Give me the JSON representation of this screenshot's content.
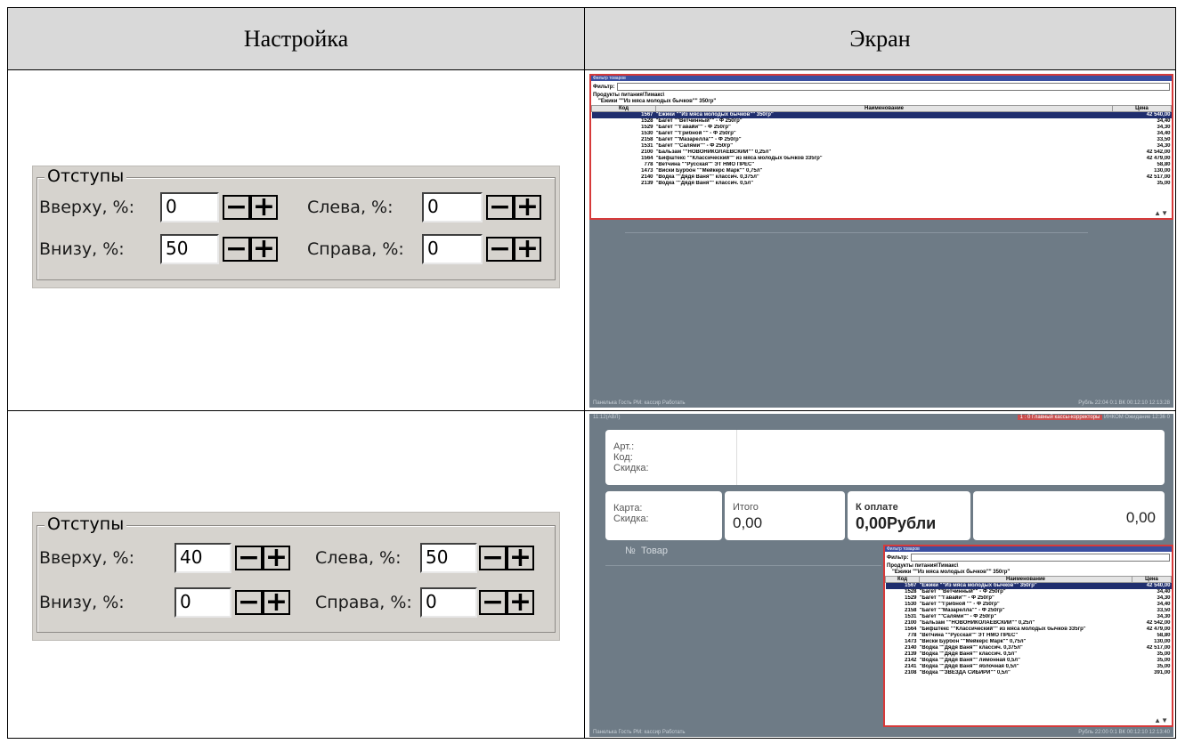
{
  "header": {
    "col1": "Настройка",
    "col2": "Экран"
  },
  "settings": {
    "group_title": "Отступы",
    "labels": {
      "top": "Вверху, %:",
      "bottom": "Внизу, %:",
      "left": "Слева, %:",
      "right": "Справа, %:"
    },
    "minus": "−",
    "plus": "+",
    "row1": {
      "top": "0",
      "bottom": "50",
      "left": "0",
      "right": "0"
    },
    "row2": {
      "top": "40",
      "bottom": "0",
      "left": "50",
      "right": "0"
    }
  },
  "screen": {
    "popup_title": "Фильтр товаров",
    "filter_label": "Фильтр:",
    "crumb1": "Продукты питания\\Тимакс\\",
    "crumb2": "\"Ежики \"\"Из мяса молодых бычков\"\" 350гр\"",
    "col_code": "Код",
    "col_name": "Наименование",
    "col_price": "Цена",
    "items1": [
      {
        "k": "1567",
        "n": "\"Ежики \"\"Из мяса молодых бычков\"\" 350гр\"",
        "p": "42 540,00"
      },
      {
        "k": "1528",
        "n": "\"Багет \"\"Ветчинный\"\" - Ф 250гр\"",
        "p": "34,40"
      },
      {
        "k": "1529",
        "n": "\"Багет \"\"Гавайи\"\" - Ф 250гр\"",
        "p": "34,30"
      },
      {
        "k": "1530",
        "n": "\"Багет \"\"Грибной \"\" - Ф 250гр\"",
        "p": "34,40"
      },
      {
        "k": "2158",
        "n": "\"Багет \"\"Мазарелла\"\" - Ф 250гр\"",
        "p": "33,50"
      },
      {
        "k": "1531",
        "n": "\"Багет \"\"Салями\"\" - Ф 250гр\"",
        "p": "34,30"
      },
      {
        "k": "2100",
        "n": "\"Бальзам \"\"НОВОНИКОЛАЕВСКИЙ\"\" 0,25л\"",
        "p": "42 542,00"
      },
      {
        "k": "1564",
        "n": "\"Бифштекс \"\"Классический\"\" из мяса молодых бычков 335гр\"",
        "p": "42 479,00"
      },
      {
        "k": "778",
        "n": "\"Ветчина \"\"Русская\"\" ЭТ НМО ПРЕС\"",
        "p": "58,80"
      },
      {
        "k": "1473",
        "n": "\"Виски Бурбон \"\"Мейкерс Марк\"\" 0,75л\"",
        "p": "130,00"
      },
      {
        "k": "2140",
        "n": "\"Водка \"\"Дядя Ваня\"\" классич. 0,375л\"",
        "p": "42 517,00"
      },
      {
        "k": "2139",
        "n": "\"Водка \"\"Дядя Ваня\"\" классич. 0,5л\"",
        "p": "35,00"
      }
    ],
    "items2": [
      {
        "k": "1567",
        "n": "\"Ежики \"\"Из мяса молодых бычков\"\" 350гр\"",
        "p": "42 540,00"
      },
      {
        "k": "1528",
        "n": "\"Багет \"\"Ветчинный\"\" - Ф 250гр\"",
        "p": "34,40"
      },
      {
        "k": "1529",
        "n": "\"Багет \"\"Гавайи\"\" - Ф 250гр\"",
        "p": "34,30"
      },
      {
        "k": "1530",
        "n": "\"Багет \"\"Грибной \"\" - Ф 250гр\"",
        "p": "34,40"
      },
      {
        "k": "2158",
        "n": "\"Багет \"\"Мазарелла\"\" - Ф 250гр\"",
        "p": "33,50"
      },
      {
        "k": "1531",
        "n": "\"Багет \"\"Салями\"\" - Ф 250гр\"",
        "p": "34,30"
      },
      {
        "k": "2100",
        "n": "\"Бальзам \"\"НОВОНИКОЛАЕВСКИЙ\"\" 0,25л\"",
        "p": "42 542,00"
      },
      {
        "k": "1564",
        "n": "\"Бифштекс \"\"Классический\"\" из мяса молодых бычков 335гр\"",
        "p": "42 479,00"
      },
      {
        "k": "778",
        "n": "\"Ветчина \"\"Русская\"\" ЭТ НМО ПРЕС\"",
        "p": "58,80"
      },
      {
        "k": "1473",
        "n": "\"Виски Бурбон \"\"Мейкерс Марк\"\" 0,75л\"",
        "p": "130,00"
      },
      {
        "k": "2140",
        "n": "\"Водка \"\"Дядя Ваня\"\" классич. 0,375л\"",
        "p": "42 517,00"
      },
      {
        "k": "2139",
        "n": "\"Водка \"\"Дядя Ваня\"\" классич. 0,5л\"",
        "p": "35,00"
      },
      {
        "k": "2142",
        "n": "\"Водка \"\"Дядя Ваня\"\" лимонная 0,5л\"",
        "p": "35,00"
      },
      {
        "k": "2141",
        "n": "\"Водка \"\"Дядя Ваня\"\" яблочная 0,5л\"",
        "p": "35,00"
      },
      {
        "k": "2108",
        "n": "\"Водка \"\"ЗВЕЗДА СИБИРИ\"\" 0,5л\"",
        "p": "391,00"
      }
    ],
    "taskbar_left": "Панелька Гость   РМ: кассир   Работать",
    "taskbar_right1": "Рубль   22:04   0:1   ВК 00:12:10  12:13:28",
    "taskbar_right2": "Рубль   22:00   0:1   ВК 00:12:10  12:13:40",
    "top_left": "11:12(АВЛ)",
    "top_red": "1 : 0   Главный кассы-корректоры",
    "top_right": "ИНКОМ   Ожидание 12:36 0",
    "card_art": "Арт.:",
    "card_code": "Код:",
    "card_disc": "Скидка:",
    "card_card": "Карта:",
    "card_disc2": "Скидка:",
    "total_label": "Итого",
    "total_val": "0,00",
    "pay_label": "К оплате",
    "pay_val": "0,00Рубли",
    "change_val": "0,00",
    "col_no": "№",
    "col_goods": "Товар"
  }
}
